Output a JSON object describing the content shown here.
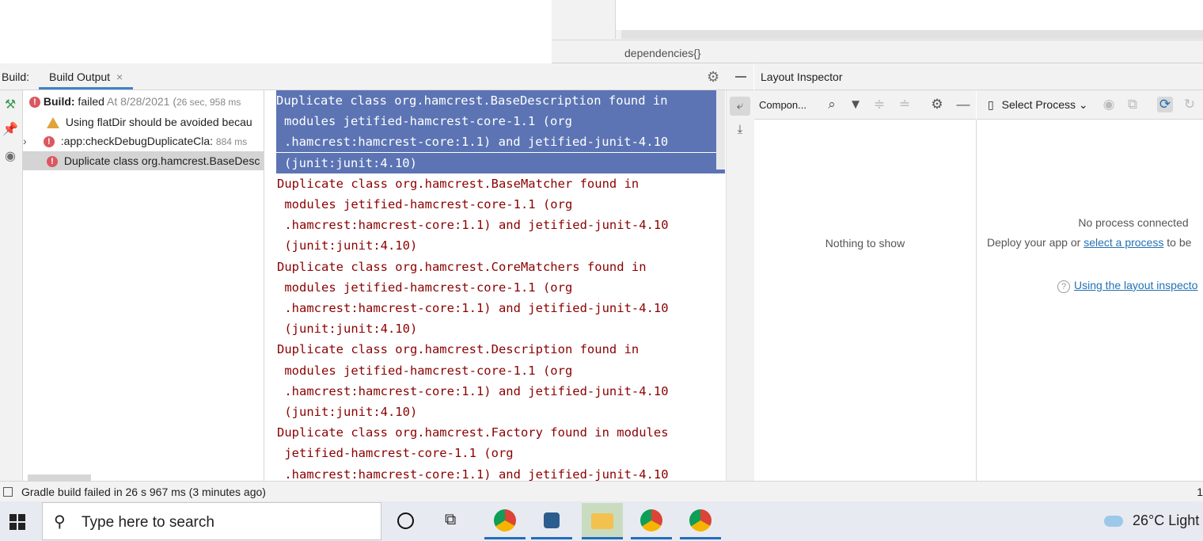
{
  "editor": {
    "breadcrumb": "dependencies{}"
  },
  "build": {
    "label": "Build:",
    "tab": "Build Output",
    "tab_close": "×",
    "tree": [
      {
        "bold": "Build:",
        "text": " failed",
        "detail": " At 8/28/2021 (",
        "time": "26 sec, 958 ms"
      },
      {
        "text": "Using flatDir should be avoided becau"
      },
      {
        "expander": "›",
        "text": ":app:checkDebugDuplicateCla:",
        "time": "884 ms"
      },
      {
        "text": "Duplicate class org.hamcrest.BaseDesc"
      }
    ],
    "console_lines": [
      "Duplicate class org.hamcrest.BaseDescription found in",
      "modules jetified-hamcrest-core-1.1 (org",
      ".hamcrest:hamcrest-core:1.1) and jetified-junit-4.10",
      "(junit:junit:4.10)",
      "Duplicate class org.hamcrest.BaseMatcher found in",
      " modules jetified-hamcrest-core-1.1 (org",
      " .hamcrest:hamcrest-core:1.1) and jetified-junit-4.10",
      " (junit:junit:4.10)",
      "Duplicate class org.hamcrest.CoreMatchers found in",
      " modules jetified-hamcrest-core-1.1 (org",
      " .hamcrest:hamcrest-core:1.1) and jetified-junit-4.10",
      " (junit:junit:4.10)",
      "Duplicate class org.hamcrest.Description found in",
      " modules jetified-hamcrest-core-1.1 (org",
      " .hamcrest:hamcrest-core:1.1) and jetified-junit-4.10",
      " (junit:junit:4.10)",
      "Duplicate class org.hamcrest.Factory found in modules",
      " jetified-hamcrest-core-1.1 (org",
      " .hamcrest:hamcrest-core:1.1) and jetified-junit-4.10"
    ]
  },
  "layout_inspector": {
    "title": "Layout Inspector",
    "component_tree_label": "Compon...",
    "nothing_to_show": "Nothing to show",
    "select_process": "Select Process",
    "no_process": "No process connected",
    "deploy_prefix": "Deploy your app or ",
    "deploy_link": "select a process",
    "deploy_suffix": " to be",
    "help_link": "Using the layout inspecto"
  },
  "status": {
    "text": "Gradle build failed in 26 s 967 ms (3 minutes ago)",
    "right": "1"
  },
  "taskbar": {
    "search_placeholder": "Type here to search",
    "weather": "26°C  Light"
  },
  "colors": {
    "selection": "#5c74b4",
    "error_text": "#8b0000",
    "accent": "#4083c9",
    "link": "#2470b3"
  }
}
